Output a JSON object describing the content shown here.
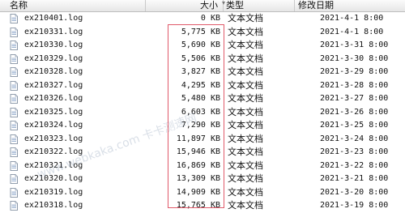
{
  "columns": {
    "name": "名称",
    "size": "大小",
    "type": "类型",
    "date": "修改日期"
  },
  "files": [
    {
      "name": "ex210401.log",
      "size": "0 KB",
      "type": "文本文档",
      "date": "2021-4-1 8:00"
    },
    {
      "name": "ex210331.log",
      "size": "5,775 KB",
      "type": "文本文档",
      "date": "2021-4-1 8:00"
    },
    {
      "name": "ex210330.log",
      "size": "5,690 KB",
      "type": "文本文档",
      "date": "2021-3-31 8:00"
    },
    {
      "name": "ex210329.log",
      "size": "5,506 KB",
      "type": "文本文档",
      "date": "2021-3-30 8:00"
    },
    {
      "name": "ex210328.log",
      "size": "3,827 KB",
      "type": "文本文档",
      "date": "2021-3-29 8:00"
    },
    {
      "name": "ex210327.log",
      "size": "4,295 KB",
      "type": "文本文档",
      "date": "2021-3-28 8:00"
    },
    {
      "name": "ex210326.log",
      "size": "5,480 KB",
      "type": "文本文档",
      "date": "2021-3-27 8:00"
    },
    {
      "name": "ex210325.log",
      "size": "6,603 KB",
      "type": "文本文档",
      "date": "2021-3-26 8:00"
    },
    {
      "name": "ex210324.log",
      "size": "7,290 KB",
      "type": "文本文档",
      "date": "2021-3-25 8:00"
    },
    {
      "name": "ex210323.log",
      "size": "11,897 KB",
      "type": "文本文档",
      "date": "2021-3-24 8:00"
    },
    {
      "name": "ex210322.log",
      "size": "15,946 KB",
      "type": "文本文档",
      "date": "2021-3-23 8:00"
    },
    {
      "name": "ex210321.log",
      "size": "16,869 KB",
      "type": "文本文档",
      "date": "2021-3-22 8:00"
    },
    {
      "name": "ex210320.log",
      "size": "13,309 KB",
      "type": "文本文档",
      "date": "2021-3-21 8:00"
    },
    {
      "name": "ex210319.log",
      "size": "14,909 KB",
      "type": "文本文档",
      "date": "2021-3-20 8:00"
    },
    {
      "name": "ex210318.log",
      "size": "15,765 KB",
      "type": "文本文档",
      "date": "2021-3-19 8:00"
    }
  ],
  "watermark": "www.webkaka.com 卡卡测速网",
  "icon": "text-file-icon",
  "highlight_color": "#e05a6a"
}
